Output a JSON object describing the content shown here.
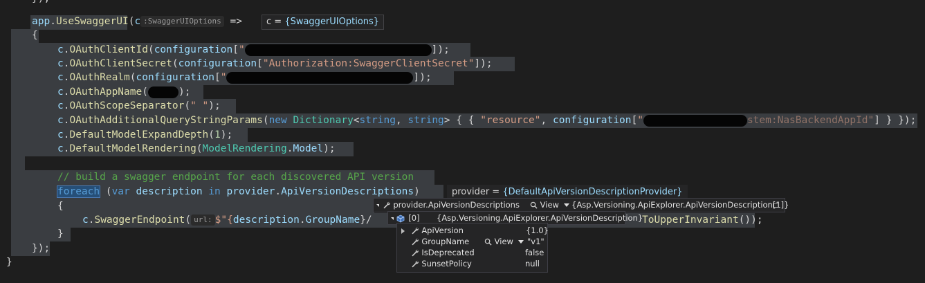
{
  "editor": {
    "line_0": "});",
    "line_1_obj": "app",
    "line_1_call": "UseSwaggerUI",
    "line_1_param": "c",
    "line_1_hint": ":SwaggerUIOptions",
    "line_1_arrow": "=>",
    "line_1_tip_prefix": "c = ",
    "line_1_tip_value": "{SwaggerUIOptions}",
    "line_2": "{",
    "line_3_call": "OAuthClientId",
    "line_3_arg": "configuration",
    "line_3_str_start": "\"",
    "line_4_call": "OAuthClientSecret",
    "line_4_arg": "configuration",
    "line_4_str": "\"Authorization:SwaggerClientSecret\"",
    "line_5_call": "OAuthRealm",
    "line_5_arg": "configuration",
    "line_5_str_start": "\"",
    "line_6_call": "OAuthAppName",
    "line_7_call": "OAuthScopeSeparator",
    "line_7_str": "\" \"",
    "line_8_call": "OAuthAdditionalQueryStringParams",
    "line_8_new": "new",
    "line_8_type": "Dictionary",
    "line_8_t1": "string",
    "line_8_t2": "string",
    "line_8_key": "\"resource\"",
    "line_8_arg": "configuration",
    "line_8_str_tail": "stem:NasBackendAppId\"",
    "line_9_call": "DefaultModelExpandDepth",
    "line_9_num": "1",
    "line_10_call": "DefaultModelRendering",
    "line_10_type": "ModelRendering",
    "line_10_member": "Model",
    "line_12_comment": "// build a swagger endpoint for each discovered API version",
    "line_13_foreach": "foreach",
    "line_13_var": "var",
    "line_13_name": "description",
    "line_13_in": "in",
    "line_13_provider": "provider",
    "line_13_member": "ApiVersionDescriptions",
    "line_13_tip_prefix": "provider = ",
    "line_13_tip_value": "{DefaultApiVersionDescriptionProvider}",
    "line_14": "{",
    "line_15_call": "SwaggerEndpoint",
    "line_15_hint": "url:",
    "line_15_interp": "$\"{",
    "line_15_name": "description",
    "line_15_member": "GroupName",
    "line_15_tail_call": "ToUpperInvariant",
    "line_16": "}",
    "line_17": "});",
    "line_18": "}",
    "c": "c"
  },
  "datatip": {
    "header_name": "provider.ApiVersionDescriptions",
    "header_view": "View",
    "header_value": "{Asp.Versioning.ApiExplorer.ApiVersionDescription[1]}",
    "item_index": "[0]",
    "item_value": "{Asp.Versioning.ApiExplorer.ApiVersionDescription}",
    "properties": [
      {
        "name": "ApiVersion",
        "value": "{1.0}"
      },
      {
        "name": "GroupName",
        "view": "View",
        "value": "\"v1\""
      },
      {
        "name": "IsDeprecated",
        "value": "false"
      },
      {
        "name": "SunsetPolicy",
        "value": "null"
      }
    ]
  },
  "colors": {
    "background": "#1e1e1e",
    "selection": "#3a3d41",
    "keyword": "#569cd6",
    "type": "#4ec9b0",
    "method": "#dcdcaa",
    "identifier": "#9cdcfe",
    "string": "#d69d85",
    "comment": "#57a64a"
  }
}
